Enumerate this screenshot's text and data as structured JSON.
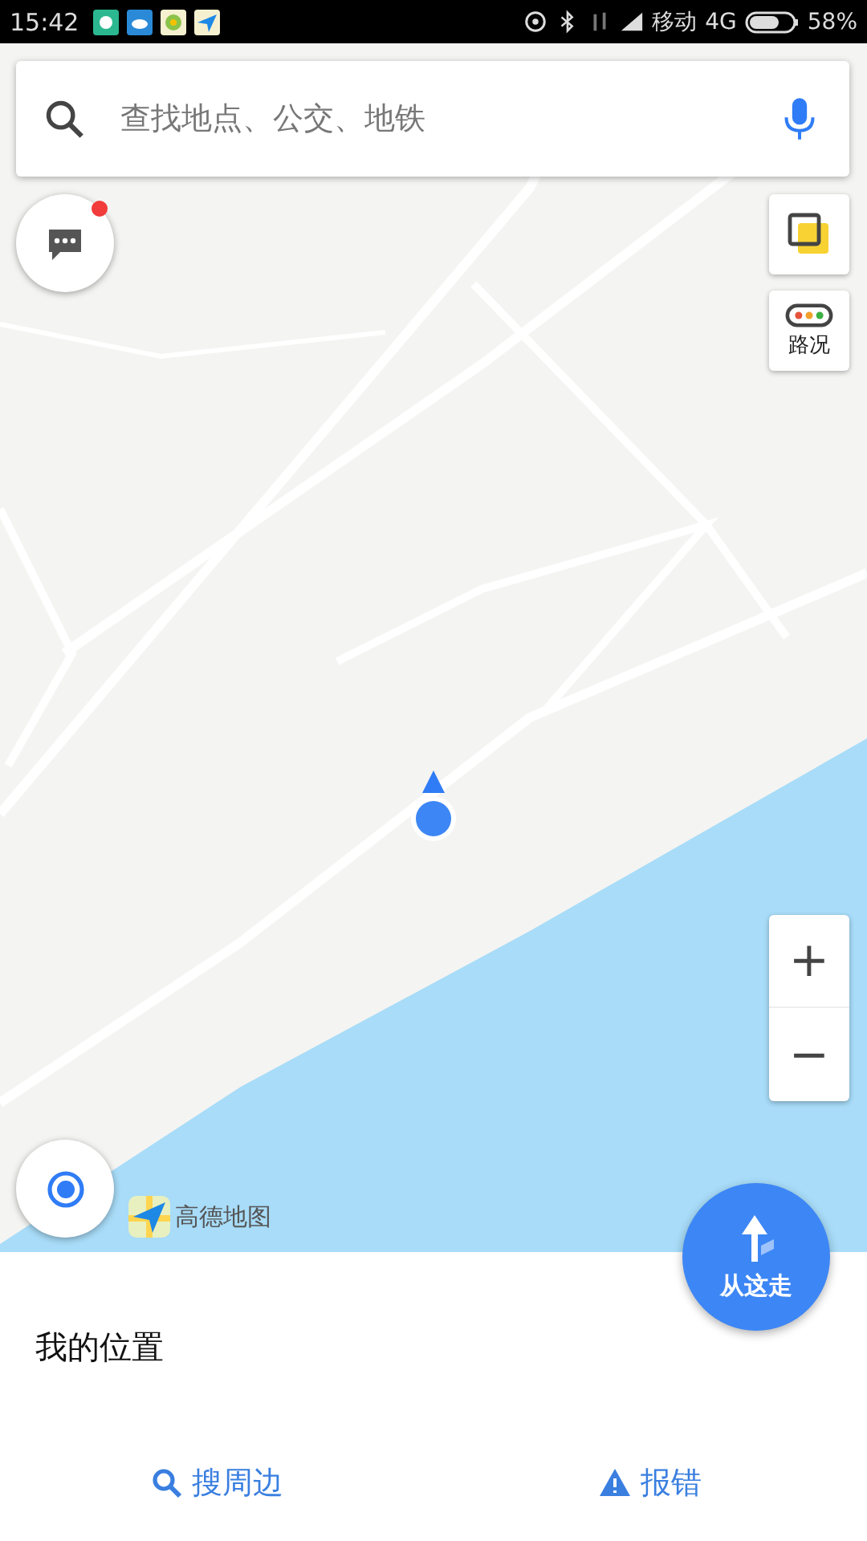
{
  "status_bar": {
    "time": "15:42",
    "carrier": "移动",
    "network": "4G",
    "battery": "58%"
  },
  "search": {
    "placeholder": "查找地点、公交、地铁"
  },
  "message_button": {
    "has_notification": true
  },
  "traffic_button": {
    "label": "路况"
  },
  "zoom": {
    "zoom_in": "+",
    "zoom_out": "−"
  },
  "logo": {
    "text": "高德地图"
  },
  "go_button": {
    "label": "从这走"
  },
  "place": {
    "title": "我的位置"
  },
  "actions": [
    {
      "label": "搜周边",
      "kind": "search"
    },
    {
      "label": "报错",
      "kind": "report"
    }
  ]
}
